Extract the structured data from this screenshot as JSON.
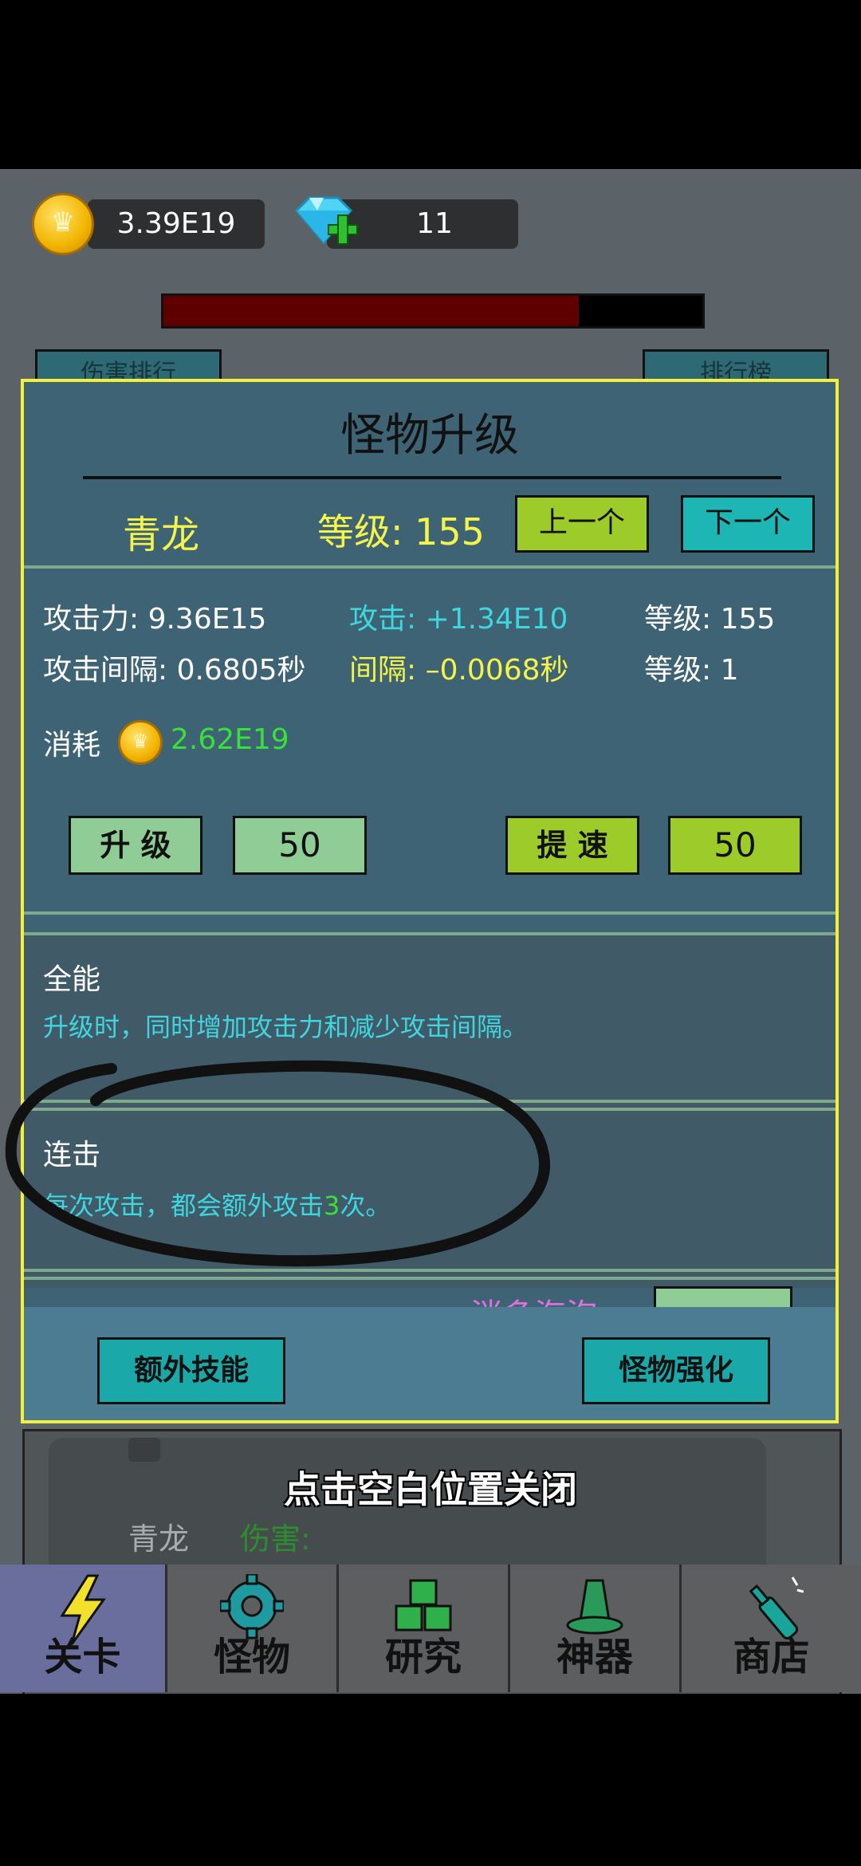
{
  "currency": {
    "gold_value": "3.39E19",
    "gem_value": "11"
  },
  "background": {
    "tab_left": "伤害排行",
    "tab_right": "排行榜",
    "monster_name": "青龙",
    "damage_label": "伤害:"
  },
  "progress_bar": {
    "fill_fraction": 0.77,
    "color": "#5e0000"
  },
  "dialog": {
    "title": "怪物升级",
    "monster_name": "青龙",
    "level_text": "等级: 155",
    "prev_button": "上一个",
    "next_button": "下一个",
    "stats": {
      "attack_label": "攻击力: 9.36E15",
      "attack_gain": "攻击: +1.34E10",
      "attack_level": "等级: 155",
      "interval_label": "攻击间隔: 0.6805秒",
      "interval_gain": "间隔: –0.0068秒",
      "interval_level": "等级: 1",
      "cost_label": "消耗",
      "cost_value": "2.62E19"
    },
    "actions": {
      "upgrade_button": "升 级",
      "upgrade_count": "50",
      "speedup_button": "提 速",
      "speedup_count": "50"
    },
    "skills": [
      {
        "name": "全能",
        "desc": "升级时，同时增加攻击力和减少攻击间隔。"
      },
      {
        "name": "连击",
        "desc_before": "每次攻击，都会额外攻击",
        "desc_highlight": "3",
        "desc_after": "次。"
      }
    ],
    "partial_row_text": "消多海泡",
    "footer": {
      "extra_skill_button": "额外技能",
      "monster_enhance_button": "怪物强化"
    }
  },
  "close_hint": "点击空白位置关闭",
  "nav": [
    {
      "label": "关卡",
      "icon": "lightning-icon"
    },
    {
      "label": "怪物",
      "icon": "gear-icon"
    },
    {
      "label": "研究",
      "icon": "cubes-icon"
    },
    {
      "label": "神器",
      "icon": "helmet-icon"
    },
    {
      "label": "商店",
      "icon": "bottle-icon"
    }
  ],
  "colors": {
    "accent_yellow": "#f2f03a",
    "gain_cyan": "#3fd6e0",
    "gain_green": "#3ae03a",
    "dialog_bg": "#3e6374"
  }
}
